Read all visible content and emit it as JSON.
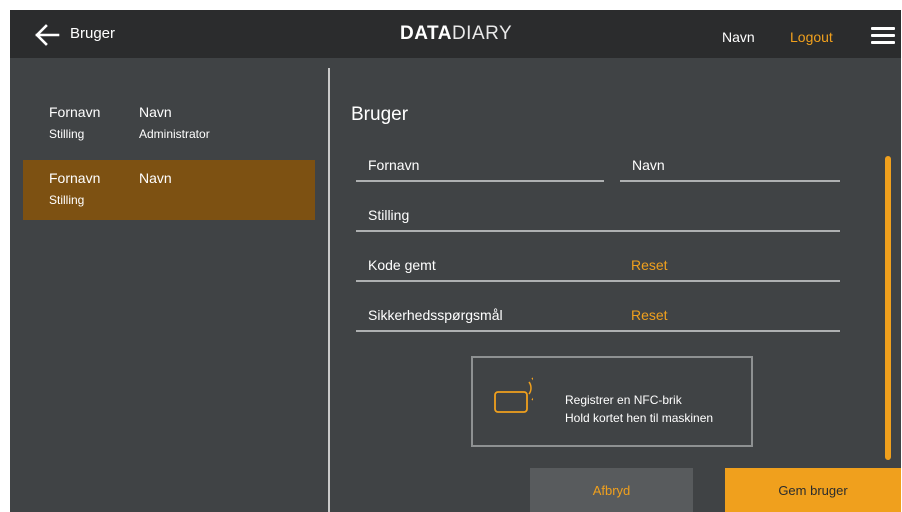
{
  "header": {
    "page_name": "Bruger",
    "logo_bold": "DATA",
    "logo_light": "DIARY",
    "user_name": "Navn",
    "logout_label": "Logout",
    "back_icon": "arrow-left-icon",
    "menu_icon": "hamburger-icon"
  },
  "users": [
    {
      "first_name": "Fornavn",
      "last_name": "Navn",
      "role": "Stilling",
      "type": "Administrator",
      "selected": false
    },
    {
      "first_name": "Fornavn",
      "last_name": "Navn",
      "role": "Stilling",
      "selected": true
    }
  ],
  "form": {
    "title": "Bruger",
    "first_name_label": "Fornavn",
    "last_name_label": "Navn",
    "role_label": "Stilling",
    "code_label": "Kode gemt",
    "code_action": "Reset",
    "security_label": "Sikkerhedsspørgsmål",
    "security_action": "Reset"
  },
  "nfc": {
    "line1": "Registrer en NFC-brik",
    "line2": "Hold kortet hen til maskinen",
    "icon": "nfc-card-icon"
  },
  "buttons": {
    "cancel_label": "Afbryd",
    "save_label": "Gem bruger"
  },
  "colors": {
    "accent": "#f0a01d",
    "topbar": "#2b2c2d",
    "background": "#404345",
    "selected_row": "#7d5112"
  }
}
